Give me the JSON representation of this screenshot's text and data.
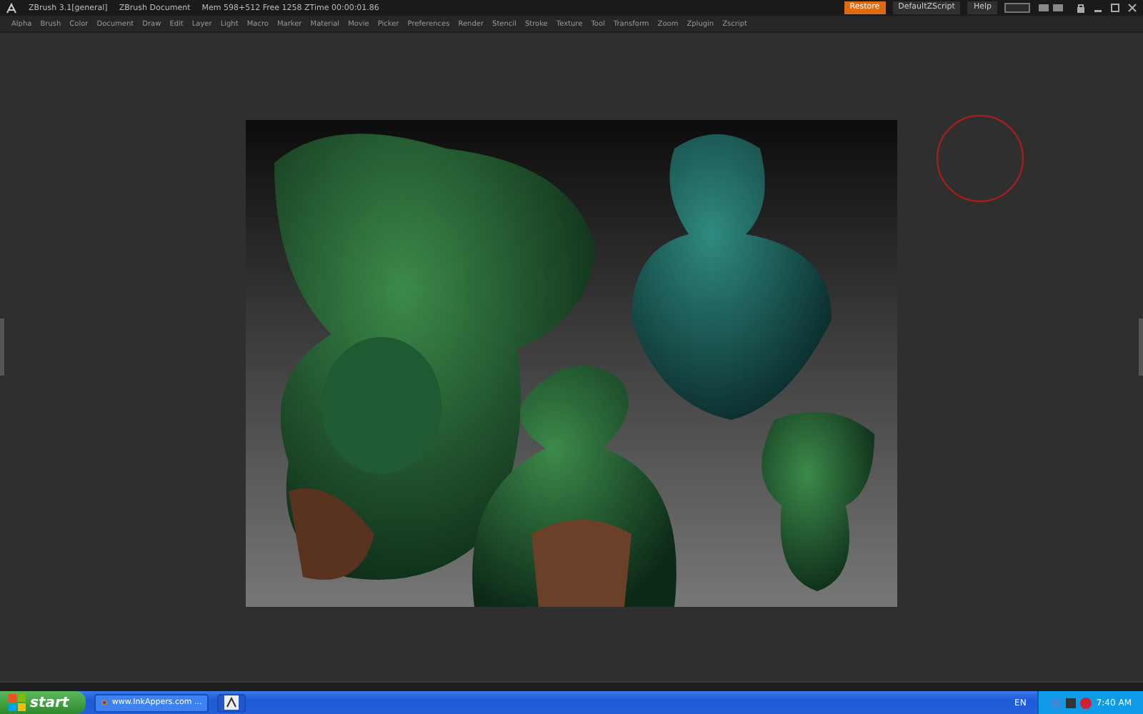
{
  "title_bar": {
    "app": "ZBrush 3.1[general]",
    "document": "ZBrush Document",
    "stats": "Mem 598+512 Free 1258 ZTime 00:00:01.86"
  },
  "menu": [
    "Alpha",
    "Brush",
    "Color",
    "Document",
    "Draw",
    "Edit",
    "Layer",
    "Light",
    "Macro",
    "Marker",
    "Material",
    "Movie",
    "Picker",
    "Preferences",
    "Render",
    "Stencil",
    "Stroke",
    "Texture",
    "Tool",
    "Transform",
    "Zoom",
    "Zplugin",
    "Zscript"
  ],
  "top_buttons": [
    {
      "label": "Restore",
      "kind": "accent"
    },
    {
      "label": "DefaultZScript",
      "kind": "plain"
    },
    {
      "label": "Help",
      "kind": "plain"
    }
  ],
  "taskbar": {
    "start": "start",
    "tasks": [
      {
        "label": "www.InkAppers.com ...",
        "kind": "browser"
      },
      {
        "kind": "app"
      }
    ],
    "language": "EN",
    "clock": "7:40 AM"
  }
}
